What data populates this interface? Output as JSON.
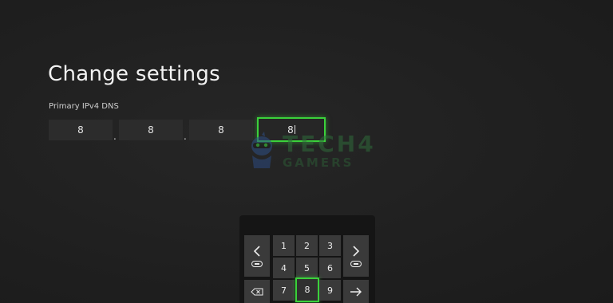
{
  "page": {
    "title": "Change settings"
  },
  "dns_field": {
    "label": "Primary IPv4 DNS",
    "octets": [
      "8",
      "8",
      "8",
      "8"
    ],
    "separator": ".",
    "focused_octet": 4
  },
  "keyboard": {
    "digit_keys": [
      "1",
      "2",
      "3",
      "4",
      "5",
      "6",
      "7",
      "8",
      "9"
    ],
    "selected_key": "8",
    "side_keys": {
      "left": "chevron-left-icon",
      "right": "chevron-right-icon",
      "backspace": "backspace-icon",
      "enter": "arrow-right-icon"
    },
    "bumper_hints": [
      "LB",
      "RB"
    ]
  },
  "watermark": {
    "line1": "TECH4",
    "line2": "GAMERS"
  },
  "colors": {
    "background": "#202020",
    "focus_accent": "#3bd13b",
    "key_bg": "#3a3a3a",
    "text": "#f2f2f2"
  }
}
